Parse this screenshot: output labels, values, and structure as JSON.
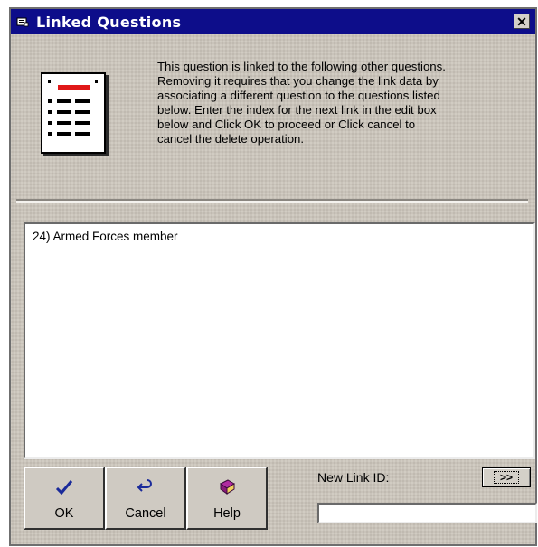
{
  "window": {
    "title": "Linked Questions",
    "close_label": "✕"
  },
  "message": "This question is linked to the following other questions.\nRemoving it requires that you change the link data by\nassociating a different question to the questions listed\nbelow. Enter the index for the next link in the edit box\nbelow and Click OK to proceed or Click cancel to\ncancel the delete operation.",
  "linked_list": {
    "items": [
      "24) Armed Forces member"
    ]
  },
  "buttons": {
    "ok_label": "OK",
    "cancel_label": "Cancel",
    "help_label": "Help"
  },
  "new_link": {
    "label": "New Link ID:",
    "arrow_label": ">>",
    "value": ""
  },
  "colors": {
    "titlebar": "#0d0d8a",
    "icon_red_bar": "#e01818",
    "ok_check": "#1a2a9a",
    "help_book": "#8a1a7a"
  }
}
